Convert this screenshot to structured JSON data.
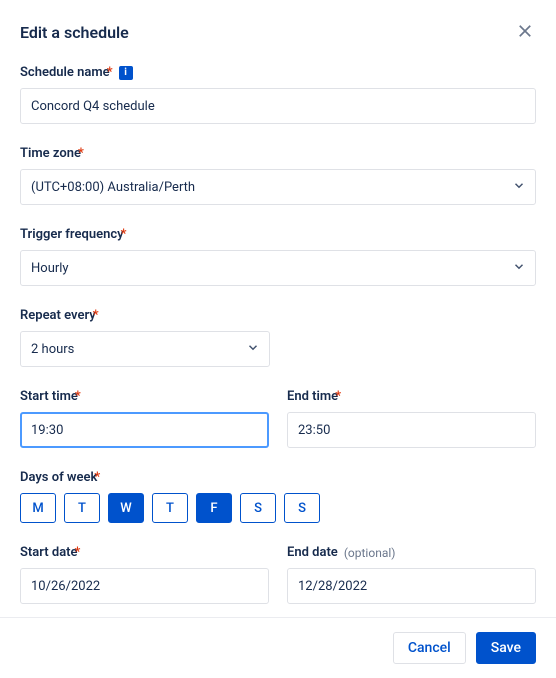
{
  "header": {
    "title": "Edit a schedule"
  },
  "form": {
    "scheduleName": {
      "label": "Schedule name",
      "value": "Concord Q4 schedule"
    },
    "timeZone": {
      "label": "Time zone",
      "value": "(UTC+08:00) Australia/Perth"
    },
    "triggerFrequency": {
      "label": "Trigger frequency",
      "value": "Hourly"
    },
    "repeatEvery": {
      "label": "Repeat every",
      "value": "2 hours"
    },
    "startTime": {
      "label": "Start time",
      "value": "19:30"
    },
    "endTime": {
      "label": "End time",
      "value": "23:50"
    },
    "daysOfWeek": {
      "label": "Days of week",
      "days": [
        "M",
        "T",
        "W",
        "T",
        "F",
        "S",
        "S"
      ],
      "selected": [
        2,
        4
      ]
    },
    "startDate": {
      "label": "Start date",
      "value": "10/26/2022"
    },
    "endDate": {
      "label": "End date",
      "optional": "(optional)",
      "value": "12/28/2022"
    }
  },
  "footer": {
    "cancel": "Cancel",
    "save": "Save"
  }
}
